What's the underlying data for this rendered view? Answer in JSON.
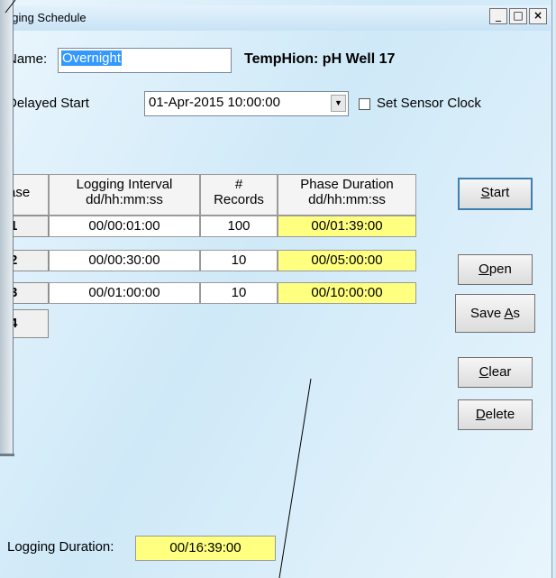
{
  "window": {
    "title": "gging Schedule",
    "min": "_",
    "max": "□",
    "close": "×"
  },
  "form": {
    "name_label": "Name:",
    "name_value": "Overnight",
    "device": "TempHion: pH Well 17",
    "delayed_label": "Delayed Start",
    "delayed_value": "01-Apr-2015 10:00:00",
    "set_clock_label": "Set Sensor Clock",
    "set_clock_checked": false
  },
  "table": {
    "headers": {
      "phase": "ase",
      "interval_1": "Logging Interval",
      "interval_2": "dd/hh:mm:ss",
      "records_1": "#",
      "records_2": "Records",
      "duration_1": "Phase Duration",
      "duration_2": "dd/hh:mm:ss"
    },
    "rows": [
      {
        "phase": "1",
        "interval": "00/00:01:00",
        "records": "100",
        "duration": "00/01:39:00"
      },
      {
        "phase": "2",
        "interval": "00/00:30:00",
        "records": "10",
        "duration": "00/05:00:00"
      },
      {
        "phase": "3",
        "interval": "00/01:00:00",
        "records": "10",
        "duration": "00/10:00:00"
      },
      {
        "phase": "4"
      }
    ]
  },
  "buttons": {
    "start_u": "S",
    "start_rest": "tart",
    "open_u": "O",
    "open_rest": "pen",
    "saveas_pre": "Save ",
    "saveas_u": "A",
    "saveas_rest": "s",
    "clear_u": "C",
    "clear_rest": "lear",
    "delete_u": "D",
    "delete_rest": "elete"
  },
  "footer": {
    "duration_label": "Logging Duration:",
    "duration_value": "00/16:39:00"
  },
  "colors": {
    "highlight": "#ffff80",
    "selection": "#3399ff"
  }
}
